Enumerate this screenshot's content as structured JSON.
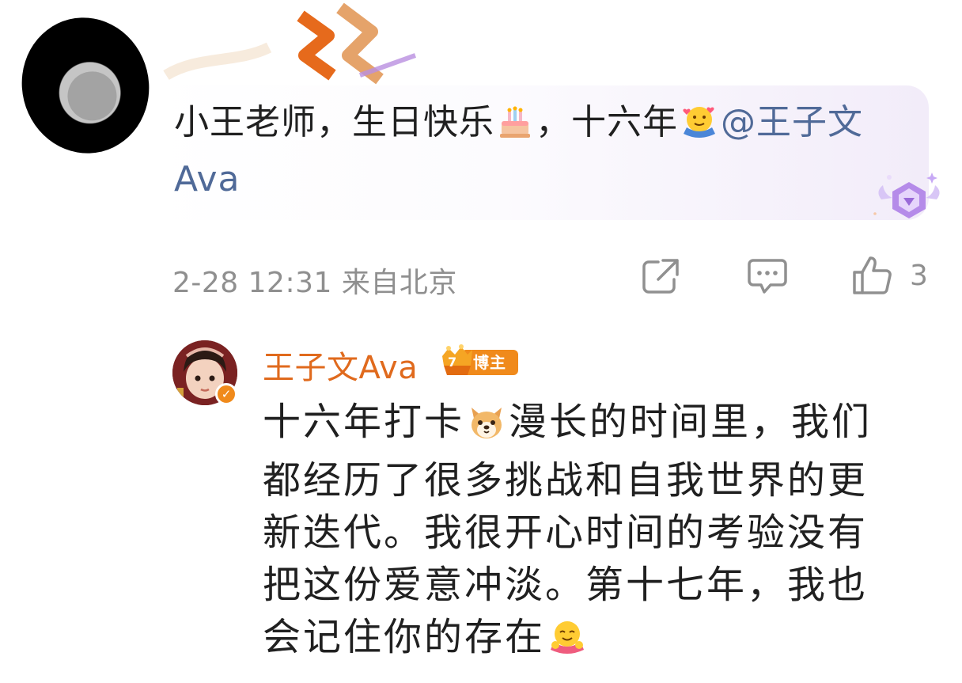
{
  "comment": {
    "text_before": "小王老师，生日快乐",
    "text_middle": "，十六年",
    "mention": "@王子文Ava",
    "emoji_1": "cake-emoji",
    "emoji_2": "hug-emoji",
    "time": "2-28 12:31",
    "location": "来自北京",
    "like_count": "3",
    "icons": {
      "share": "share-icon",
      "comment": "comment-icon",
      "like": "thumbs-up-icon"
    }
  },
  "reply": {
    "author": "王子文Ava",
    "badge_label": "博主",
    "badge_level": "7",
    "text_part1": "十六年打卡",
    "text_part2": "漫长的时间里，我们都经历了很多挑战和自我世界的更新迭代。我很开心时间的考验没有把这份爱意冲淡。第十七年，我也会记住你的存在",
    "emoji_1": "dog-emoji",
    "emoji_2": "hug-emoji"
  },
  "colors": {
    "mention": "#506a98",
    "author": "#e06a1d",
    "meta_gray": "#8f8f8f",
    "badge_orange": "#f08a1b",
    "bubble_tint": "#f2ecf9"
  }
}
